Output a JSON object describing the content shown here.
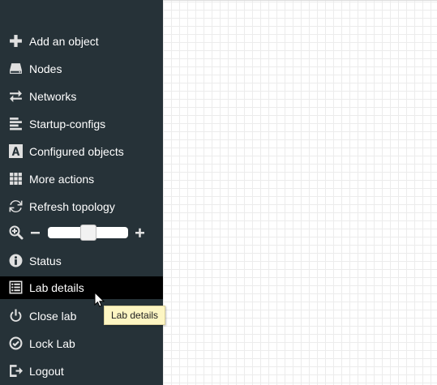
{
  "sidebar": {
    "items": [
      {
        "label": "Add an object",
        "icon": "plus-icon"
      },
      {
        "label": "Nodes",
        "icon": "hdd-icon"
      },
      {
        "label": "Networks",
        "icon": "transfer-icon"
      },
      {
        "label": "Startup-configs",
        "icon": "align-left-icon"
      },
      {
        "label": "Configured objects",
        "icon": "font-icon"
      },
      {
        "label": "More actions",
        "icon": "th-icon"
      },
      {
        "label": "Refresh topology",
        "icon": "refresh-icon"
      },
      {
        "label": "Status",
        "icon": "info-icon"
      },
      {
        "label": "Lab details",
        "icon": "list-alt-icon",
        "active": true
      },
      {
        "label": "Close lab",
        "icon": "power-icon"
      },
      {
        "label": "Lock Lab",
        "icon": "ok-circle-icon"
      },
      {
        "label": "Logout",
        "icon": "logout-icon"
      }
    ],
    "zoom": {
      "level_percent": 50
    }
  },
  "tooltip": {
    "text": "Lab details"
  },
  "colors": {
    "sidebar_bg": "#263238",
    "active_item_bg": "#000000",
    "tooltip_bg": "#fdf6c3",
    "canvas_grid": "#ececec"
  }
}
